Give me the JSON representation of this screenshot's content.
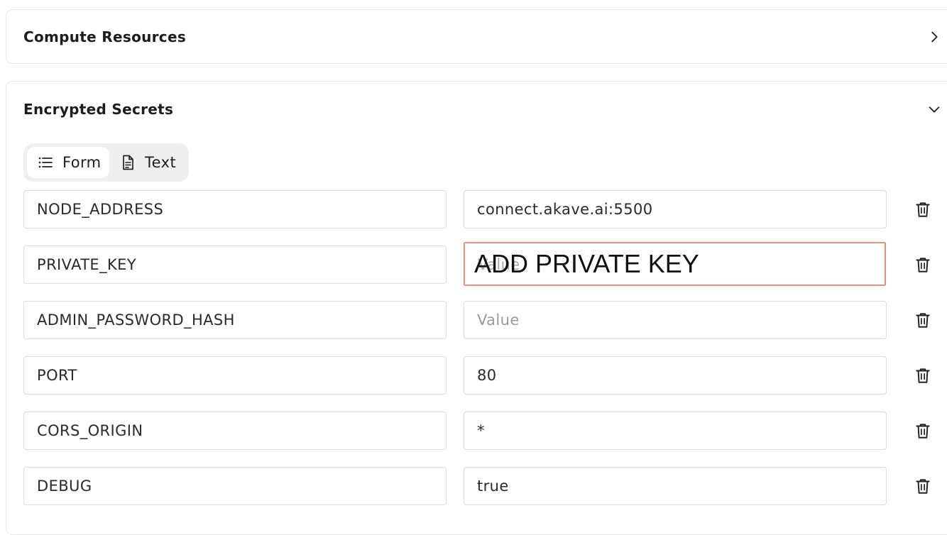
{
  "sections": {
    "compute": {
      "title": "Compute Resources",
      "expanded": false
    },
    "secrets": {
      "title": "Encrypted Secrets",
      "expanded": true
    }
  },
  "view_toggle": {
    "form_label": "Form",
    "text_label": "Text",
    "selected": "Form"
  },
  "secrets": [
    {
      "key": "NODE_ADDRESS",
      "value": "connect.akave.ai:5500",
      "placeholder": "Value"
    },
    {
      "key": "PRIVATE_KEY",
      "value": "",
      "placeholder": "Value",
      "annotation": "ADD PRIVATE KEY",
      "annotation_color": "#e8907f"
    },
    {
      "key": "ADMIN_PASSWORD_HASH",
      "value": "",
      "placeholder": "Value"
    },
    {
      "key": "PORT",
      "value": "80",
      "placeholder": "Value"
    },
    {
      "key": "CORS_ORIGIN",
      "value": "*",
      "placeholder": "Value"
    },
    {
      "key": "DEBUG",
      "value": "true",
      "placeholder": "Value"
    }
  ],
  "icons": {
    "collapsed": "chevron-right-icon",
    "expanded": "chevron-down-icon",
    "form": "list-icon",
    "text": "document-icon",
    "delete": "trash-icon"
  }
}
